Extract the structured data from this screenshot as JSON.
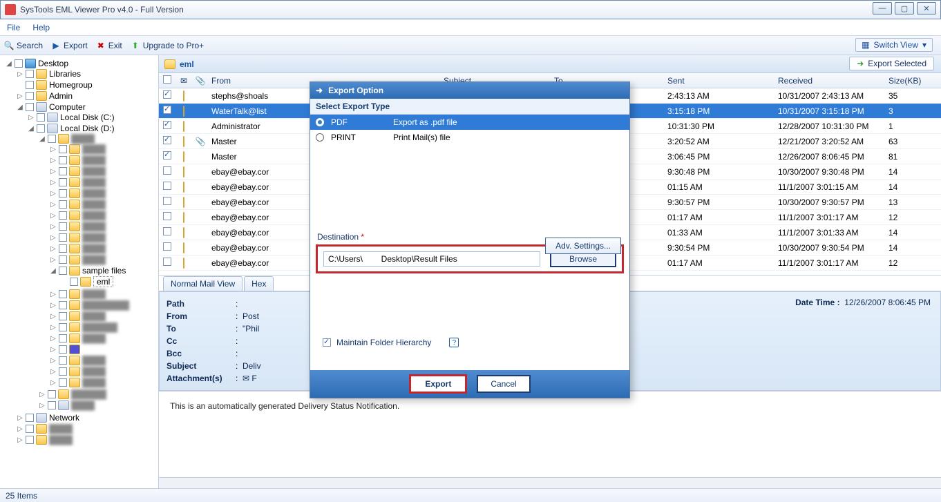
{
  "window": {
    "title": "SysTools EML Viewer Pro v4.0 - Full Version"
  },
  "menu": {
    "file": "File",
    "help": "Help"
  },
  "toolbar": {
    "search": "Search",
    "export": "Export",
    "exit": "Exit",
    "upgrade": "Upgrade to Pro+",
    "switch": "Switch View"
  },
  "tree": {
    "desktop": "Desktop",
    "libraries": "Libraries",
    "homegroup": "Homegroup",
    "admin": "Admin",
    "computer": "Computer",
    "cdrive": "Local Disk (C:)",
    "ddrive": "Local Disk (D:)",
    "sample": "sample files",
    "eml": "eml",
    "network": "Network"
  },
  "pathHeader": "eml",
  "exportSelected": "Export Selected",
  "columns": {
    "from": "From",
    "subject": "Subject",
    "to": "To",
    "sent": "Sent",
    "received": "Received",
    "size": "Size(KB)"
  },
  "rows": [
    {
      "chk": true,
      "att": false,
      "from": "stephs@shoals",
      "sent": "2:43:13 AM",
      "recv": "10/31/2007 2:43:13 AM",
      "size": "35"
    },
    {
      "chk": true,
      "att": false,
      "from": "WaterTalk@list",
      "sent": "3:15:18 PM",
      "recv": "10/31/2007 3:15:18 PM",
      "size": "3",
      "sel": true
    },
    {
      "chk": true,
      "att": false,
      "from": "Administrator",
      "sent": "10:31:30 PM",
      "recv": "12/28/2007 10:31:30 PM",
      "size": "1"
    },
    {
      "chk": true,
      "att": true,
      "from": "Master",
      "sent": "3:20:52 AM",
      "recv": "12/21/2007 3:20:52 AM",
      "size": "63"
    },
    {
      "chk": true,
      "att": false,
      "from": "Master",
      "sent": "3:06:45 PM",
      "recv": "12/26/2007 8:06:45 PM",
      "size": "81"
    },
    {
      "chk": false,
      "att": false,
      "from": "ebay@ebay.cor",
      "sent": "9:30:48 PM",
      "recv": "10/30/2007 9:30:48 PM",
      "size": "14"
    },
    {
      "chk": false,
      "att": false,
      "from": "ebay@ebay.cor",
      "sent": "01:15 AM",
      "recv": "11/1/2007 3:01:15 AM",
      "size": "14"
    },
    {
      "chk": false,
      "att": false,
      "from": "ebay@ebay.cor",
      "sent": "9:30:57 PM",
      "recv": "10/30/2007 9:30:57 PM",
      "size": "13"
    },
    {
      "chk": false,
      "att": false,
      "from": "ebay@ebay.cor",
      "sent": "01:17 AM",
      "recv": "11/1/2007 3:01:17 AM",
      "size": "12"
    },
    {
      "chk": false,
      "att": false,
      "from": "ebay@ebay.cor",
      "sent": "01:33 AM",
      "recv": "11/1/2007 3:01:33 AM",
      "size": "14"
    },
    {
      "chk": false,
      "att": false,
      "from": "ebay@ebay.cor",
      "sent": "9:30:54 PM",
      "recv": "10/30/2007 9:30:54 PM",
      "size": "14"
    },
    {
      "chk": false,
      "att": false,
      "from": "ebay@ebay.cor",
      "sent": "01:17 AM",
      "recv": "11/1/2007 3:01:17 AM",
      "size": "12"
    }
  ],
  "tabs": {
    "normal": "Normal Mail View",
    "hex": "Hex"
  },
  "detail": {
    "datetimeLbl": "Date Time  :",
    "datetime": "12/26/2007 8:06:45 PM",
    "path": "Path",
    "from": "From",
    "to": "To",
    "cc": "Cc",
    "bcc": "Bcc",
    "subject": "Subject",
    "attach": "Attachment(s)",
    "fromVal": "Post",
    "toVal": "\"Phil",
    "subjVal": "Deliv",
    "attVal": "F"
  },
  "bodyText": "This is an automatically generated Delivery Status Notification.",
  "status": "25 Items",
  "dialog": {
    "title": "Export Option",
    "selectType": "Select Export Type",
    "pdf": "PDF",
    "pdfDesc": "Export as .pdf file",
    "print": "PRINT",
    "printDesc": "Print Mail(s) file",
    "adv": "Adv. Settings...",
    "dest": "Destination",
    "path": "C:\\Users\\        Desktop\\Result Files",
    "browse": "Browse",
    "maintain": "Maintain Folder Hierarchy",
    "export": "Export",
    "cancel": "Cancel"
  }
}
